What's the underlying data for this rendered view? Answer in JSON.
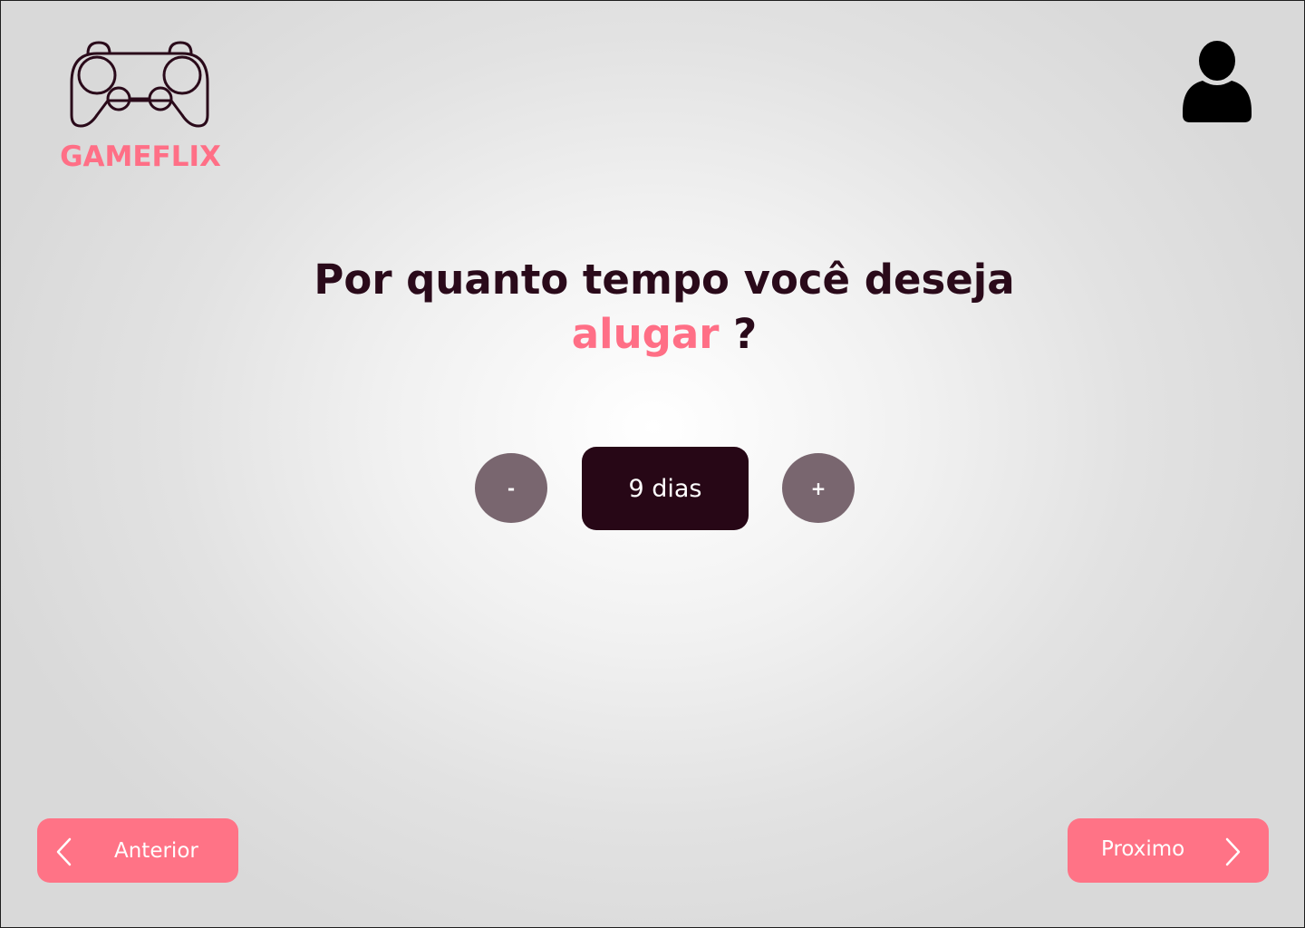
{
  "brand": {
    "name": "GAMEFLIX",
    "logo_icon": "gamepad-icon",
    "accent_color": "#ff6f86",
    "dark_color": "#270716"
  },
  "header": {
    "user_icon": "user-icon"
  },
  "question": {
    "line1": "Por quanto tempo você deseja",
    "highlight": "alugar",
    "suffix": "?"
  },
  "stepper": {
    "decrement_label": "-",
    "value": "9 dias",
    "increment_label": "+"
  },
  "navigation": {
    "previous_label": "Anterior",
    "previous_icon": "chevron-left-icon",
    "next_label": "Proximo",
    "next_icon": "chevron-right-icon"
  }
}
